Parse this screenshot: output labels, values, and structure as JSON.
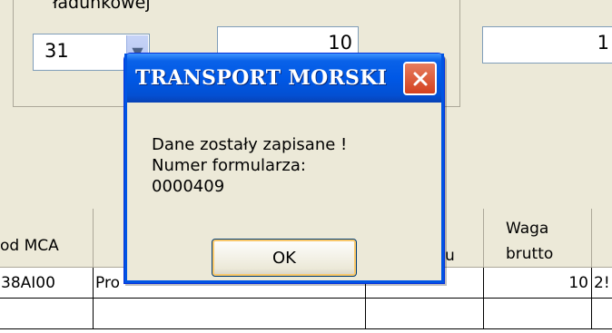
{
  "form": {
    "label_clipped": "ładunkowej",
    "day_value": "31",
    "quantity_value": "10",
    "third_value": "1"
  },
  "table": {
    "headers": {
      "col_code": "od MCA",
      "col_partial": "u",
      "col_weight_line1": "Waga",
      "col_weight_line2": "brutto"
    },
    "row1": {
      "code": "38AI00",
      "name": "Pro",
      "weight": "10",
      "next": "2!"
    }
  },
  "dialog": {
    "title": "TRANSPORT MORSKI",
    "line1": "Dane zostały zapisane !",
    "line2": "Numer formularza:",
    "line3": "0000409",
    "ok_label": "OK"
  }
}
